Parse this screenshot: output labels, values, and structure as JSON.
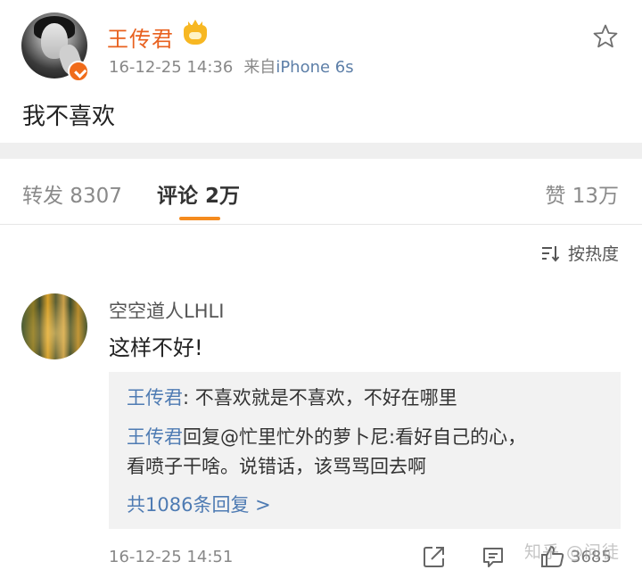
{
  "post": {
    "author_name": "王传君",
    "author_badge_icon": "crown-icon",
    "verified_icon": "verified-badge-icon",
    "time": "16-12-25 14:36",
    "via_label": "来自",
    "via_device": "iPhone 6s",
    "text": "我不喜欢",
    "favorite_icon": "star-icon"
  },
  "tabs": {
    "repost": "转发 8307",
    "comments": "评论 2万",
    "likes": "赞 13万",
    "active": "comments"
  },
  "sort": {
    "label": "按热度",
    "icon": "sort-icon"
  },
  "comment": {
    "user": "空空道人LHLI",
    "text": "这样不好!",
    "replies": [
      {
        "user": "王传君",
        "text": ": 不喜欢就是不喜欢，不好在哪里"
      },
      {
        "user": "王传君",
        "text": "回复@忙里忙外的萝卜尼:看好自己的心，",
        "continuation": "看喷子干啥。说错话，该骂骂回去啊"
      }
    ],
    "more_replies": "共1086条回复 >",
    "time": "16-12-25 14:51",
    "like_count": "3685"
  },
  "watermark": "知乎 @问徒",
  "colors": {
    "accent_orange": "#e8611f",
    "link_blue": "#4e7bb3",
    "tab_underline": "#f58b1e",
    "meta_gray": "#888888"
  }
}
